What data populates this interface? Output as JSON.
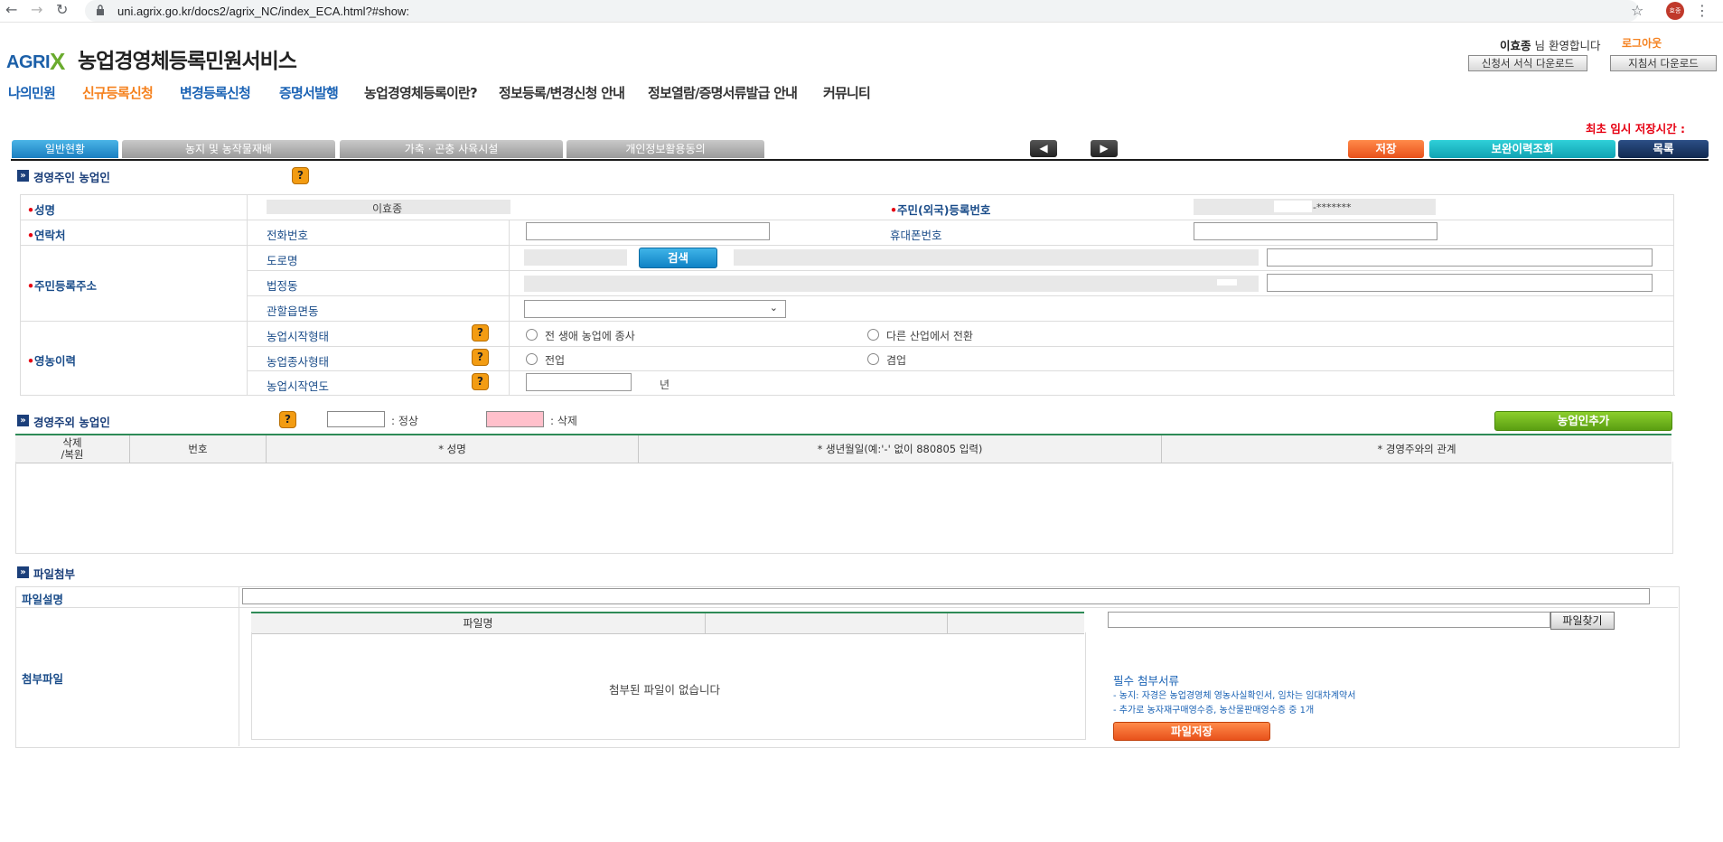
{
  "browser": {
    "url": "uni.agrix.go.kr/docs2/agrix_NC/index_ECA.html?#show:",
    "profile_initials": "효종"
  },
  "header": {
    "logo_text": "AGRI",
    "logo_x": "X",
    "site_title": "농업경영체등록민원서비스",
    "user_name": "이효종",
    "welcome_suffix": "님 환영합니다",
    "logout": "로그아웃",
    "download_form": "신청서 서식 다운로드",
    "download_guide": "지침서 다운로드"
  },
  "menu": {
    "items": [
      "나의민원",
      "신규등록신청",
      "변경등록신청",
      "증명서발행",
      "농업경영체등록이란?",
      "정보등록/변경신청 안내",
      "정보열람/증명서류발급 안내",
      "커뮤니티"
    ]
  },
  "temp_save_label": "최초 임시 저장시간 :",
  "tabs": [
    "일반현황",
    "농지 및 농작물재배",
    "가축 · 곤충 사육시설",
    "개인정보활용동의"
  ],
  "toolbar": {
    "prev": "◀",
    "next": "▶",
    "save": "저장",
    "security_history": "보완이력조회",
    "list": "목록"
  },
  "section_owner": {
    "title": "경영주인 농업인",
    "help": "?",
    "name_label": "성명",
    "name_value": "이효종",
    "rrn_label": "주민(외국)등록번호",
    "rrn_value": "-*******",
    "contact_label": "연락처",
    "phone_label": "전화번호",
    "mobile_label": "휴대폰번호",
    "address_label": "주민등록주소",
    "road_label": "도로명",
    "search_btn": "검색",
    "legal_dong_label": "법정동",
    "jurisdiction_label": "관할읍면동",
    "farming_career_label": "영농이력",
    "start_type_label": "농업시작형태",
    "start_type_opt1": "전 생애 농업에 종사",
    "start_type_opt2": "다른 산업에서 전환",
    "work_type_label": "농업종사형태",
    "work_type_opt1": "전업",
    "work_type_opt2": "겸업",
    "start_year_label": "농업시작연도",
    "year_unit": "년"
  },
  "section_others": {
    "title": "경영주외 농업인",
    "legend_normal": ": 정상",
    "legend_deleted": ": 삭제",
    "add_btn": "농업인추가",
    "col_delete": "삭제\n/복원",
    "col_number": "번호",
    "col_name": "* 성명",
    "col_birth": "* 생년월일(예:'-' 없이 880805 입력)",
    "col_relation": "* 경영주와의 관계"
  },
  "section_files": {
    "title": "파일첨부",
    "desc_label": "파일설명",
    "attach_label": "첨부파일",
    "col_filename": "파일명",
    "empty_msg": "첨부된 파일이 없습니다",
    "find_btn": "파일찾기",
    "required_title": "필수 첨부서류",
    "required_line1": "- 농지: 자경은 농업경영체 영농사실확인서, 임차는 임대차계약서",
    "required_line2": "- 추가로 농자재구매영수증, 농산물판매영수증 중 1개",
    "save_btn": "파일저장"
  },
  "colors": {
    "brand_blue": "#1b63b5",
    "accent_orange": "#f5821f",
    "tab_active": "#1b7fc1",
    "add_green": "#5a9e12",
    "save_red": "#e8511b",
    "deleted_pink": "#ffc0cb"
  }
}
